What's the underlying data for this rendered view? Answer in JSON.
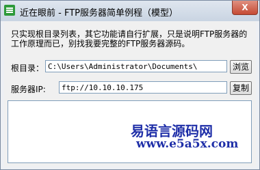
{
  "window": {
    "title": "近在眼前 - FTP服务器简单例程（模型）",
    "close_label": "X",
    "app_icon": "app-logo-icon"
  },
  "description": "只实现根目录列表，其它功能请自行扩展，只是说明FTP服务器的工作原理而已，别找我要完整的FTP服务器源码。",
  "root_dir": {
    "label": "根目录：",
    "value": "C:\\Users\\Administrator\\Documents\\",
    "browse_label": "浏览"
  },
  "server_ip": {
    "label": "服务器IP:",
    "value": "ftp://10.10.10.175",
    "copy_label": "复制"
  },
  "log": {
    "value": ""
  },
  "watermark": {
    "line1": "易语言源码网",
    "line2": "www.e5a5x.com"
  }
}
